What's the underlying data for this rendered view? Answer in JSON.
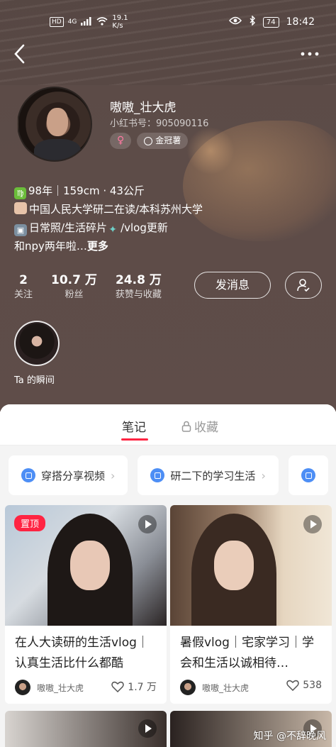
{
  "status_bar": {
    "network": "4G",
    "hd": "HD",
    "speed_value": "19.1",
    "speed_unit": "K/s",
    "battery": "74",
    "time": "18:42"
  },
  "profile": {
    "username": "嗷嗷_壮大虎",
    "redbook_id": "小红书号：905090116",
    "gender_symbol": "♀",
    "badge_label": "金冠薯",
    "bio_line1_prefix": "♍",
    "bio_line1": "98年｜159cm · 43公斤",
    "bio_line2": "中国人民大学研二在读/本科苏州大学",
    "bio_line3_a": "日常照/生活碎片",
    "bio_line3_b": "/vlog更新",
    "bio_line4": "和npy两年啦…",
    "bio_more": "更多"
  },
  "stats": [
    {
      "value": "2",
      "label": "关注"
    },
    {
      "value": "10.7 万",
      "label": "粉丝"
    },
    {
      "value": "24.8 万",
      "label": "获赞与收藏"
    }
  ],
  "actions": {
    "message_label": "发消息"
  },
  "moments": {
    "label": "Ta 的瞬间"
  },
  "tabs": {
    "notes": "笔记",
    "collect": "收藏"
  },
  "collections": [
    {
      "label": "穿搭分享视频"
    },
    {
      "label": "研二下的学习生活"
    }
  ],
  "notes": [
    {
      "title": "在人大读研的生活vlog｜认真生活比什么都酷",
      "pinned": "置顶",
      "author": "嗷嗷_壮大虎",
      "likes": "1.7 万"
    },
    {
      "title": "暑假vlog｜宅家学习｜学会和生活以诚相待…",
      "author": "嗷嗷_壮大虎",
      "likes": "538"
    }
  ],
  "watermark": "知乎 @不辞晚风",
  "colors": {
    "accent": "#ff2442",
    "header_bg": "#5d4c48",
    "collection_icon": "#4d8ef5"
  }
}
